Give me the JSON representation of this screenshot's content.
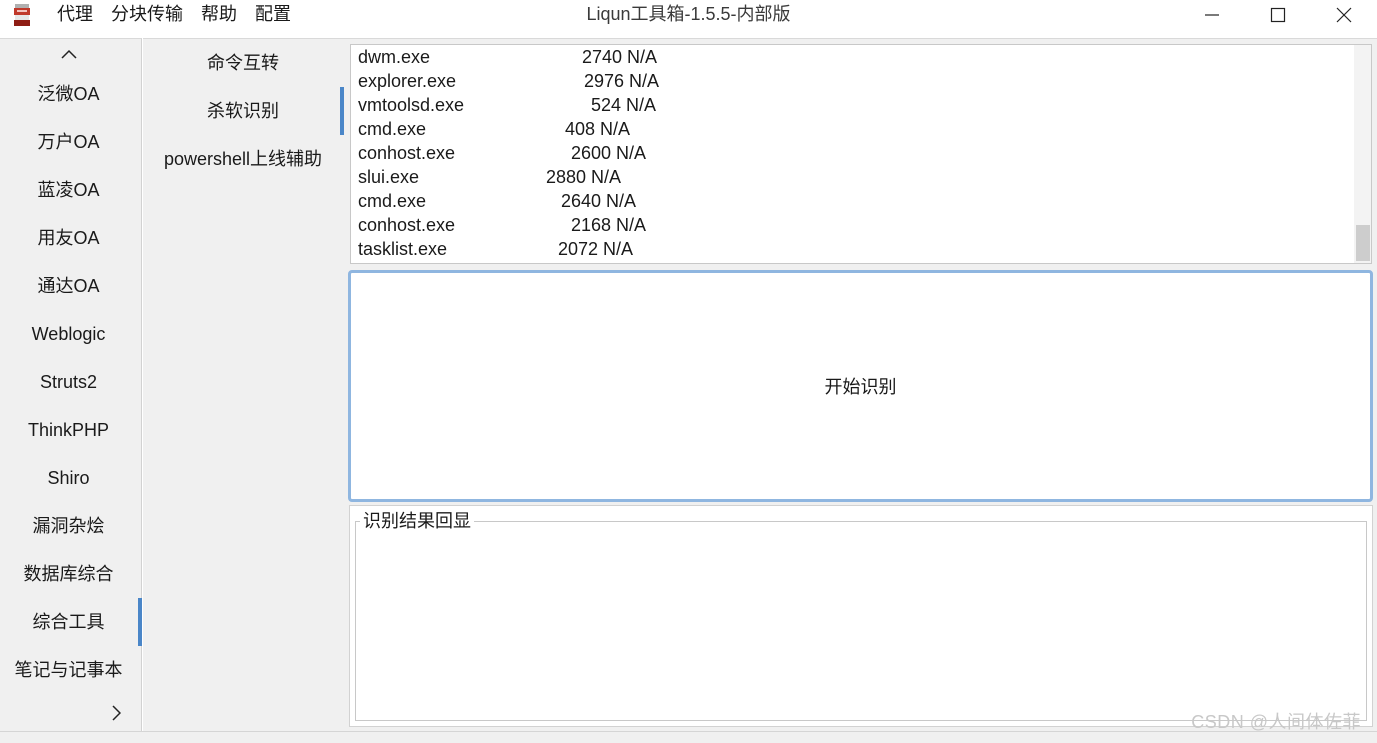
{
  "window": {
    "title": "Liqun工具箱-1.5.5-内部版",
    "controls": [
      "minimize-icon",
      "maximize-icon",
      "close-icon"
    ]
  },
  "menu": {
    "items": [
      "代理",
      "分块传输",
      "帮助",
      "配置"
    ]
  },
  "sidebar": {
    "items": [
      {
        "label": "泛微OA"
      },
      {
        "label": "万户OA"
      },
      {
        "label": "蓝凌OA"
      },
      {
        "label": "用友OA"
      },
      {
        "label": "通达OA"
      },
      {
        "label": "Weblogic"
      },
      {
        "label": "Struts2"
      },
      {
        "label": "ThinkPHP"
      },
      {
        "label": "Shiro"
      },
      {
        "label": "漏洞杂烩"
      },
      {
        "label": "数据库综合"
      },
      {
        "label": "综合工具"
      },
      {
        "label": "笔记与记事本"
      }
    ],
    "active": "综合工具",
    "scroll_icons": [
      "chevron-up-icon",
      "chevron-right-icon"
    ]
  },
  "subnav": {
    "items": [
      {
        "label": "命令互转"
      },
      {
        "label": "杀软识别"
      },
      {
        "label": "powershell上线辅助"
      }
    ],
    "active": "杀软识别"
  },
  "process_list": {
    "rows": [
      {
        "name": "dwm.exe",
        "pid": "2740",
        "mem": "N/A"
      },
      {
        "name": "explorer.exe",
        "pid": "2976",
        "mem": "N/A"
      },
      {
        "name": "vmtoolsd.exe",
        "pid": "524",
        "mem": "N/A"
      },
      {
        "name": "cmd.exe",
        "pid": "408",
        "mem": "N/A"
      },
      {
        "name": "conhost.exe",
        "pid": "2600",
        "mem": "N/A"
      },
      {
        "name": "slui.exe",
        "pid": "2880",
        "mem": "N/A"
      },
      {
        "name": "cmd.exe",
        "pid": "2640",
        "mem": "N/A"
      },
      {
        "name": "conhost.exe",
        "pid": "2168",
        "mem": "N/A"
      },
      {
        "name": "tasklist.exe",
        "pid": "2072",
        "mem": "N/A"
      }
    ]
  },
  "start_button": {
    "label": "开始识别"
  },
  "result": {
    "legend": "识别结果回显",
    "text": ""
  },
  "watermark": "CSDN @人间体佐菲",
  "colors": {
    "accent": "#4a86c8",
    "button_border": "#8fb6e0",
    "panel_bg": "#f0f0f0"
  }
}
